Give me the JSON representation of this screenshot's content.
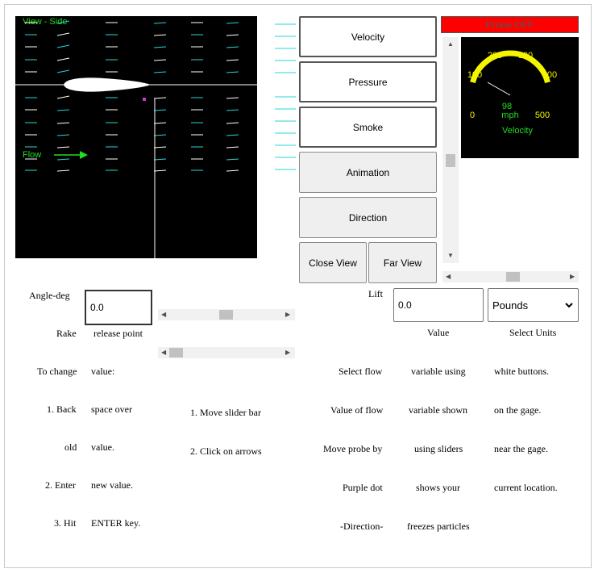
{
  "view": {
    "title": "View - Side",
    "flow_label": "Flow"
  },
  "buttons": {
    "velocity": "Velocity",
    "pressure": "Pressure",
    "smoke": "Smoke",
    "animation": "Animation",
    "direction": "Direction",
    "close_view": "Close View",
    "far_view": "Far View"
  },
  "probe": {
    "status": "Probe OFF"
  },
  "gauge": {
    "ticks": [
      "0",
      "100",
      "200",
      "300",
      "400",
      "500"
    ],
    "value": "98",
    "unit": "mph",
    "label": "Velocity",
    "min": 0,
    "max": 500,
    "reading": 98
  },
  "controls": {
    "angle_label": "Angle-deg",
    "angle_value": "0.0",
    "rake_label": "Rake",
    "release_point": "release point",
    "lift_label": "Lift",
    "lift_value": "0.0",
    "value_label": "Value",
    "units_selected": "Pounds",
    "select_units_label": "Select Units"
  },
  "instructions": {
    "left": [
      [
        "To change",
        "value:"
      ],
      [
        "1. Back",
        "space over"
      ],
      [
        "old",
        "value."
      ],
      [
        "2. Enter",
        "new value."
      ],
      [
        "3. Hit",
        "ENTER key."
      ]
    ],
    "slider_help": [
      "1. Move slider bar",
      "2. Click on arrows"
    ],
    "right": [
      [
        "Select flow",
        "variable using",
        "white buttons."
      ],
      [
        "Value of flow",
        "variable shown",
        "on the gage."
      ],
      [
        "Move probe by",
        "using sliders",
        "near the gage."
      ],
      [
        "Purple dot",
        "shows your",
        "current location."
      ],
      [
        "-Direction-",
        "freezes particles",
        ""
      ]
    ]
  },
  "colors": {
    "flow_green": "#22dd22",
    "streak_cyan": "#2ad4d4",
    "gauge_yellow": "#f5f500",
    "probe_red": "#ff0000",
    "probe_dot": "#cc33cc"
  }
}
